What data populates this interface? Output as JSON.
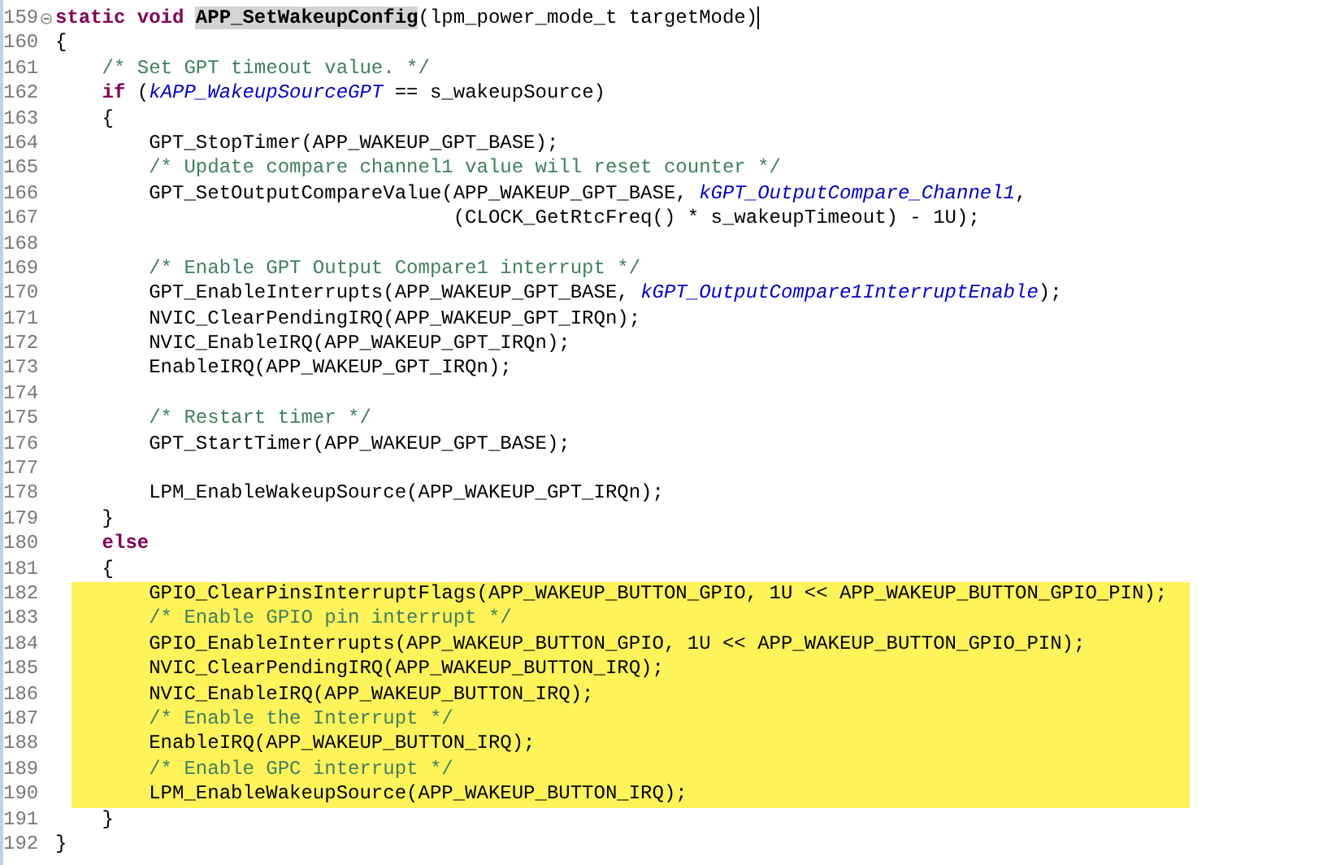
{
  "editor": {
    "lines": [
      {
        "number": "159",
        "fold": true,
        "cursor": true,
        "highlighted": false,
        "tokens": [
          {
            "kind": "keyword",
            "text": "static void "
          },
          {
            "kind": "marked",
            "text": "APP_SetWakeupConfig"
          },
          {
            "kind": "plain",
            "text": "(lpm_power_mode_t targetMode)"
          }
        ]
      },
      {
        "number": "160",
        "fold": false,
        "cursor": false,
        "highlighted": false,
        "tokens": [
          {
            "kind": "plain",
            "text": "{"
          }
        ]
      },
      {
        "number": "161",
        "fold": false,
        "cursor": false,
        "highlighted": false,
        "tokens": [
          {
            "kind": "comment",
            "text": "    /* Set GPT timeout value. */"
          }
        ]
      },
      {
        "number": "162",
        "fold": false,
        "cursor": false,
        "highlighted": false,
        "tokens": [
          {
            "kind": "keyword",
            "text": "    if"
          },
          {
            "kind": "plain",
            "text": " ("
          },
          {
            "kind": "constant",
            "text": "kAPP_WakeupSourceGPT"
          },
          {
            "kind": "plain",
            "text": " == s_wakeupSource)"
          }
        ]
      },
      {
        "number": "163",
        "fold": false,
        "cursor": false,
        "highlighted": false,
        "tokens": [
          {
            "kind": "plain",
            "text": "    {"
          }
        ]
      },
      {
        "number": "164",
        "fold": false,
        "cursor": false,
        "highlighted": false,
        "tokens": [
          {
            "kind": "plain",
            "text": "        GPT_StopTimer(APP_WAKEUP_GPT_BASE);"
          }
        ]
      },
      {
        "number": "165",
        "fold": false,
        "cursor": false,
        "highlighted": false,
        "tokens": [
          {
            "kind": "comment",
            "text": "        /* Update compare channel1 value will reset counter */"
          }
        ]
      },
      {
        "number": "166",
        "fold": false,
        "cursor": false,
        "highlighted": false,
        "tokens": [
          {
            "kind": "plain",
            "text": "        GPT_SetOutputCompareValue(APP_WAKEUP_GPT_BASE, "
          },
          {
            "kind": "constant",
            "text": "kGPT_OutputCompare_Channel1"
          },
          {
            "kind": "plain",
            "text": ","
          }
        ]
      },
      {
        "number": "167",
        "fold": false,
        "cursor": false,
        "highlighted": false,
        "tokens": [
          {
            "kind": "plain",
            "text": "                                  (CLOCK_GetRtcFreq() * s_wakeupTimeout) - 1U);"
          }
        ]
      },
      {
        "number": "168",
        "fold": false,
        "cursor": false,
        "highlighted": false
      },
      {
        "number": "169",
        "fold": false,
        "cursor": false,
        "highlighted": false,
        "tokens": [
          {
            "kind": "comment",
            "text": "        /* Enable GPT Output Compare1 interrupt */"
          }
        ]
      },
      {
        "number": "170",
        "fold": false,
        "cursor": false,
        "highlighted": false,
        "tokens": [
          {
            "kind": "plain",
            "text": "        GPT_EnableInterrupts(APP_WAKEUP_GPT_BASE, "
          },
          {
            "kind": "constant",
            "text": "kGPT_OutputCompare1InterruptEnable"
          },
          {
            "kind": "plain",
            "text": ");"
          }
        ]
      },
      {
        "number": "171",
        "fold": false,
        "cursor": false,
        "highlighted": false,
        "tokens": [
          {
            "kind": "plain",
            "text": "        NVIC_ClearPendingIRQ(APP_WAKEUP_GPT_IRQn);"
          }
        ]
      },
      {
        "number": "172",
        "fold": false,
        "cursor": false,
        "highlighted": false,
        "tokens": [
          {
            "kind": "plain",
            "text": "        NVIC_EnableIRQ(APP_WAKEUP_GPT_IRQn);"
          }
        ]
      },
      {
        "number": "173",
        "fold": false,
        "cursor": false,
        "highlighted": false,
        "tokens": [
          {
            "kind": "plain",
            "text": "        EnableIRQ(APP_WAKEUP_GPT_IRQn);"
          }
        ]
      },
      {
        "number": "174",
        "fold": false,
        "cursor": false,
        "highlighted": false
      },
      {
        "number": "175",
        "fold": false,
        "cursor": false,
        "highlighted": false,
        "tokens": [
          {
            "kind": "comment",
            "text": "        /* Restart timer */"
          }
        ]
      },
      {
        "number": "176",
        "fold": false,
        "cursor": false,
        "highlighted": false,
        "tokens": [
          {
            "kind": "plain",
            "text": "        GPT_StartTimer(APP_WAKEUP_GPT_BASE);"
          }
        ]
      },
      {
        "number": "177",
        "fold": false,
        "cursor": false,
        "highlighted": false
      },
      {
        "number": "178",
        "fold": false,
        "cursor": false,
        "highlighted": false,
        "tokens": [
          {
            "kind": "plain",
            "text": "        LPM_EnableWakeupSource(APP_WAKEUP_GPT_IRQn);"
          }
        ]
      },
      {
        "number": "179",
        "fold": false,
        "cursor": false,
        "highlighted": false,
        "tokens": [
          {
            "kind": "plain",
            "text": "    }"
          }
        ]
      },
      {
        "number": "180",
        "fold": false,
        "cursor": false,
        "highlighted": false,
        "tokens": [
          {
            "kind": "keyword",
            "text": "    else"
          }
        ]
      },
      {
        "number": "181",
        "fold": false,
        "cursor": false,
        "highlighted": false,
        "tokens": [
          {
            "kind": "plain",
            "text": "    {"
          }
        ]
      },
      {
        "number": "182",
        "fold": false,
        "cursor": false,
        "highlighted": true,
        "tokens": [
          {
            "kind": "plain",
            "text": "        GPIO_ClearPinsInterruptFlags(APP_WAKEUP_BUTTON_GPIO, 1U << APP_WAKEUP_BUTTON_GPIO_PIN);"
          }
        ]
      },
      {
        "number": "183",
        "fold": false,
        "cursor": false,
        "highlighted": true,
        "tokens": [
          {
            "kind": "comment",
            "text": "        /* Enable GPIO pin interrupt */"
          }
        ]
      },
      {
        "number": "184",
        "fold": false,
        "cursor": false,
        "highlighted": true,
        "tokens": [
          {
            "kind": "plain",
            "text": "        GPIO_EnableInterrupts(APP_WAKEUP_BUTTON_GPIO, 1U << APP_WAKEUP_BUTTON_GPIO_PIN);"
          }
        ]
      },
      {
        "number": "185",
        "fold": false,
        "cursor": false,
        "highlighted": true,
        "tokens": [
          {
            "kind": "plain",
            "text": "        NVIC_ClearPendingIRQ(APP_WAKEUP_BUTTON_IRQ);"
          }
        ]
      },
      {
        "number": "186",
        "fold": false,
        "cursor": false,
        "highlighted": true,
        "tokens": [
          {
            "kind": "plain",
            "text": "        NVIC_EnableIRQ(APP_WAKEUP_BUTTON_IRQ);"
          }
        ]
      },
      {
        "number": "187",
        "fold": false,
        "cursor": false,
        "highlighted": true,
        "tokens": [
          {
            "kind": "comment",
            "text": "        /* Enable the Interrupt */"
          }
        ]
      },
      {
        "number": "188",
        "fold": false,
        "cursor": false,
        "highlighted": true,
        "tokens": [
          {
            "kind": "plain",
            "text": "        EnableIRQ(APP_WAKEUP_BUTTON_IRQ);"
          }
        ]
      },
      {
        "number": "189",
        "fold": false,
        "cursor": false,
        "highlighted": true,
        "tokens": [
          {
            "kind": "comment",
            "text": "        /* Enable GPC interrupt */"
          }
        ]
      },
      {
        "number": "190",
        "fold": false,
        "cursor": false,
        "highlighted": true,
        "tokens": [
          {
            "kind": "plain",
            "text": "        LPM_EnableWakeupSource(APP_WAKEUP_BUTTON_IRQ);"
          }
        ]
      },
      {
        "number": "191",
        "fold": false,
        "cursor": false,
        "highlighted": false,
        "tokens": [
          {
            "kind": "plain",
            "text": "    }"
          }
        ]
      },
      {
        "number": "192",
        "fold": false,
        "cursor": false,
        "highlighted": false,
        "tokens": [
          {
            "kind": "plain",
            "text": "}"
          }
        ]
      }
    ]
  }
}
